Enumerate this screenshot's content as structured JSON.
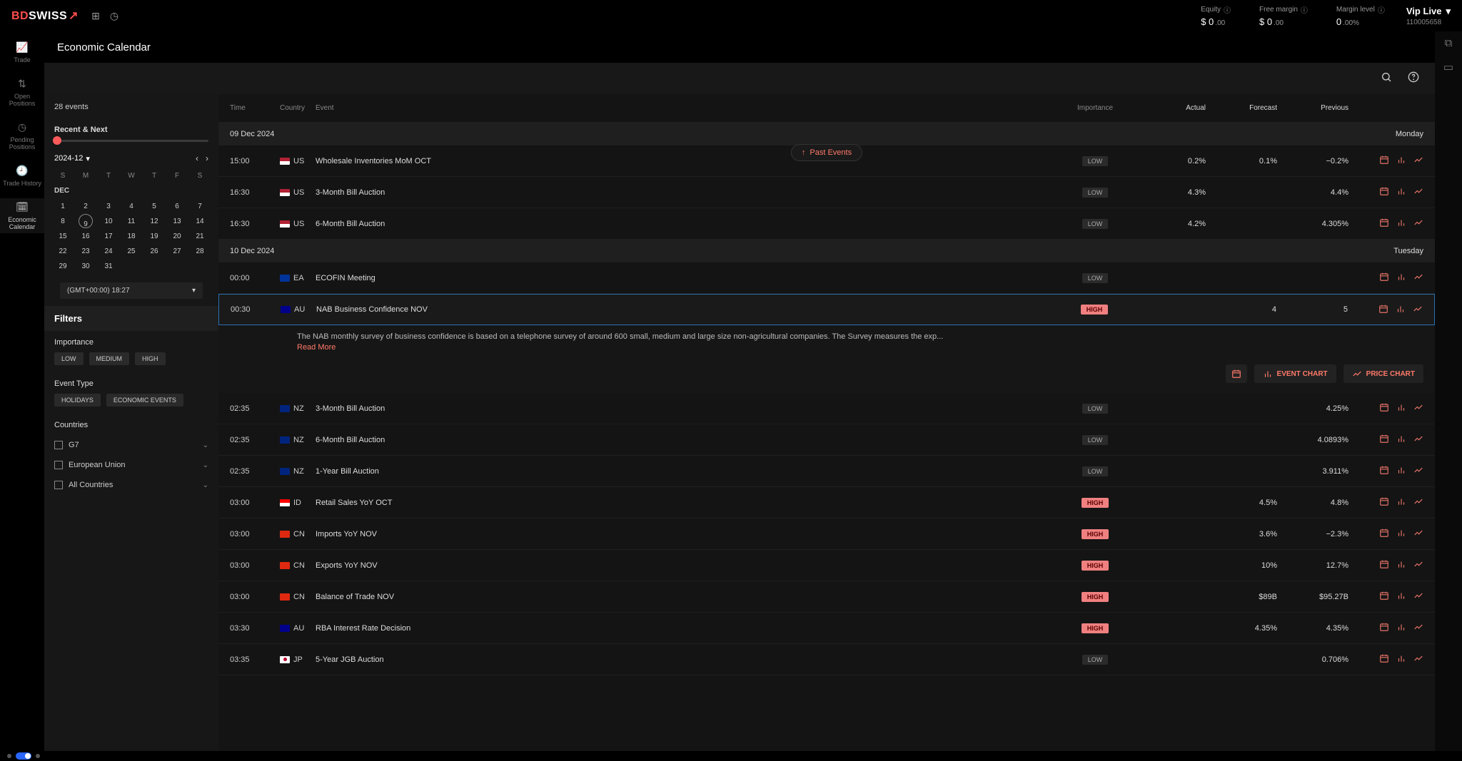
{
  "brand": {
    "bd": "BD",
    "swiss": "SWISS"
  },
  "metrics": {
    "equity_label": "Equity",
    "equity_value": "$ 0",
    "equity_sub": ".00",
    "free_label": "Free margin",
    "free_value": "$ 0",
    "free_sub": ".00",
    "margin_label": "Margin level",
    "margin_value": "0",
    "margin_sub": ".00%"
  },
  "account": {
    "name": "Vip Live",
    "num": "110005658"
  },
  "leftnav": {
    "trade": "Trade",
    "open": "Open\nPositions",
    "pending": "Pending\nPositions",
    "history": "Trade History",
    "calendar": "Economic\nCalendar"
  },
  "page_title": "Economic Calendar",
  "events_count": "28 events",
  "recent_next": "Recent & Next",
  "cal": {
    "ym": "2024-12",
    "month": "DEC",
    "dow": [
      "S",
      "M",
      "T",
      "W",
      "T",
      "F",
      "S"
    ],
    "rows": [
      [
        "1",
        "2",
        "3",
        "4",
        "5",
        "6",
        "7"
      ],
      [
        "8",
        "9",
        "10",
        "11",
        "12",
        "13",
        "14"
      ],
      [
        "15",
        "16",
        "17",
        "18",
        "19",
        "20",
        "21"
      ],
      [
        "22",
        "23",
        "24",
        "25",
        "26",
        "27",
        "28"
      ],
      [
        "29",
        "30",
        "31",
        "",
        "",
        "",
        ""
      ]
    ],
    "today": "9",
    "tz": "(GMT+00:00) 18:27"
  },
  "filters": {
    "title": "Filters",
    "importance": "Importance",
    "imp_chips": [
      "LOW",
      "MEDIUM",
      "HIGH"
    ],
    "event_type": "Event Type",
    "et_chips": [
      "HOLIDAYS",
      "ECONOMIC EVENTS"
    ],
    "countries": "Countries",
    "country_rows": [
      "G7",
      "European Union",
      "All Countries"
    ]
  },
  "hdr": {
    "time": "Time",
    "country": "Country",
    "event": "Event",
    "importance": "Importance",
    "actual": "Actual",
    "forecast": "Forecast",
    "previous": "Previous"
  },
  "past_events": "Past Events",
  "groups": [
    {
      "date": "09 Dec 2024",
      "day": "Monday",
      "rows": [
        {
          "time": "15:00",
          "cc": "US",
          "flag": "us",
          "event": "Wholesale Inventories MoM OCT",
          "imp": "LOW",
          "actual": "0.2%",
          "forecast": "0.1%",
          "previous": "−0.2%"
        },
        {
          "time": "16:30",
          "cc": "US",
          "flag": "us",
          "event": "3-Month Bill Auction",
          "imp": "LOW",
          "actual": "4.3%",
          "forecast": "",
          "previous": "4.4%"
        },
        {
          "time": "16:30",
          "cc": "US",
          "flag": "us",
          "event": "6-Month Bill Auction",
          "imp": "LOW",
          "actual": "4.2%",
          "forecast": "",
          "previous": "4.305%"
        }
      ]
    },
    {
      "date": "10 Dec 2024",
      "day": "Tuesday",
      "rows": [
        {
          "time": "00:00",
          "cc": "EA",
          "flag": "ea",
          "event": "ECOFIN Meeting",
          "imp": "LOW",
          "actual": "",
          "forecast": "",
          "previous": ""
        },
        {
          "time": "00:30",
          "cc": "AU",
          "flag": "au",
          "event": "NAB Business Confidence NOV",
          "imp": "HIGH",
          "actual": "",
          "forecast": "4",
          "previous": "5",
          "selected": true,
          "desc": "The NAB monthly survey of business confidence is based on a telephone survey of around 600 small, medium and large size non-agricultural companies. The Survey measures the exp...",
          "readmore": "Read More"
        },
        {
          "time": "02:35",
          "cc": "NZ",
          "flag": "nz",
          "event": "3-Month Bill Auction",
          "imp": "LOW",
          "actual": "",
          "forecast": "",
          "previous": "4.25%"
        },
        {
          "time": "02:35",
          "cc": "NZ",
          "flag": "nz",
          "event": "6-Month Bill Auction",
          "imp": "LOW",
          "actual": "",
          "forecast": "",
          "previous": "4.0893%"
        },
        {
          "time": "02:35",
          "cc": "NZ",
          "flag": "nz",
          "event": "1-Year Bill Auction",
          "imp": "LOW",
          "actual": "",
          "forecast": "",
          "previous": "3.911%"
        },
        {
          "time": "03:00",
          "cc": "ID",
          "flag": "id",
          "event": "Retail Sales YoY OCT",
          "imp": "HIGH",
          "actual": "",
          "forecast": "4.5%",
          "previous": "4.8%"
        },
        {
          "time": "03:00",
          "cc": "CN",
          "flag": "cn",
          "event": "Imports YoY NOV",
          "imp": "HIGH",
          "actual": "",
          "forecast": "3.6%",
          "previous": "−2.3%"
        },
        {
          "time": "03:00",
          "cc": "CN",
          "flag": "cn",
          "event": "Exports YoY NOV",
          "imp": "HIGH",
          "actual": "",
          "forecast": "10%",
          "previous": "12.7%"
        },
        {
          "time": "03:00",
          "cc": "CN",
          "flag": "cn",
          "event": "Balance of Trade NOV",
          "imp": "HIGH",
          "actual": "",
          "forecast": "$89B",
          "previous": "$95.27B"
        },
        {
          "time": "03:30",
          "cc": "AU",
          "flag": "au",
          "event": "RBA Interest Rate Decision",
          "imp": "HIGH",
          "actual": "",
          "forecast": "4.35%",
          "previous": "4.35%"
        },
        {
          "time": "03:35",
          "cc": "JP",
          "flag": "jp",
          "event": "5-Year JGB Auction",
          "imp": "LOW",
          "actual": "",
          "forecast": "",
          "previous": "0.706%"
        }
      ]
    }
  ],
  "actions": {
    "event_chart": "EVENT CHART",
    "price_chart": "PRICE CHART"
  }
}
